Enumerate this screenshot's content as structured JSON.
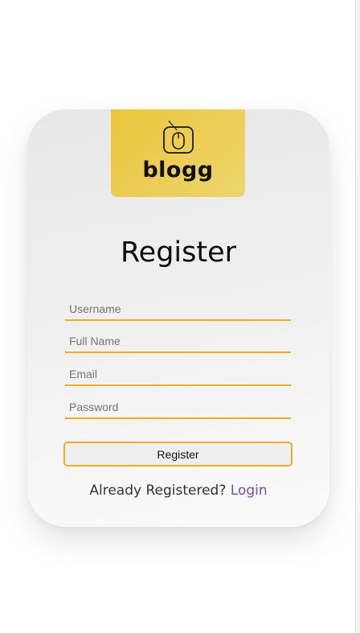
{
  "logo": {
    "icon": "mouse-icon",
    "brand": "blogg",
    "colors": {
      "from": "#ebc63c",
      "to": "#ecd56c"
    }
  },
  "title": "Register",
  "form": {
    "username_placeholder": "Username",
    "fullname_placeholder": "Full Name",
    "email_placeholder": "Email",
    "password_placeholder": "Password",
    "submit_label": "Register"
  },
  "footer": {
    "text": "Already Registered?",
    "link": "Login"
  },
  "colors": {
    "accent": "#f0ad22",
    "link": "#7a4fa8"
  }
}
